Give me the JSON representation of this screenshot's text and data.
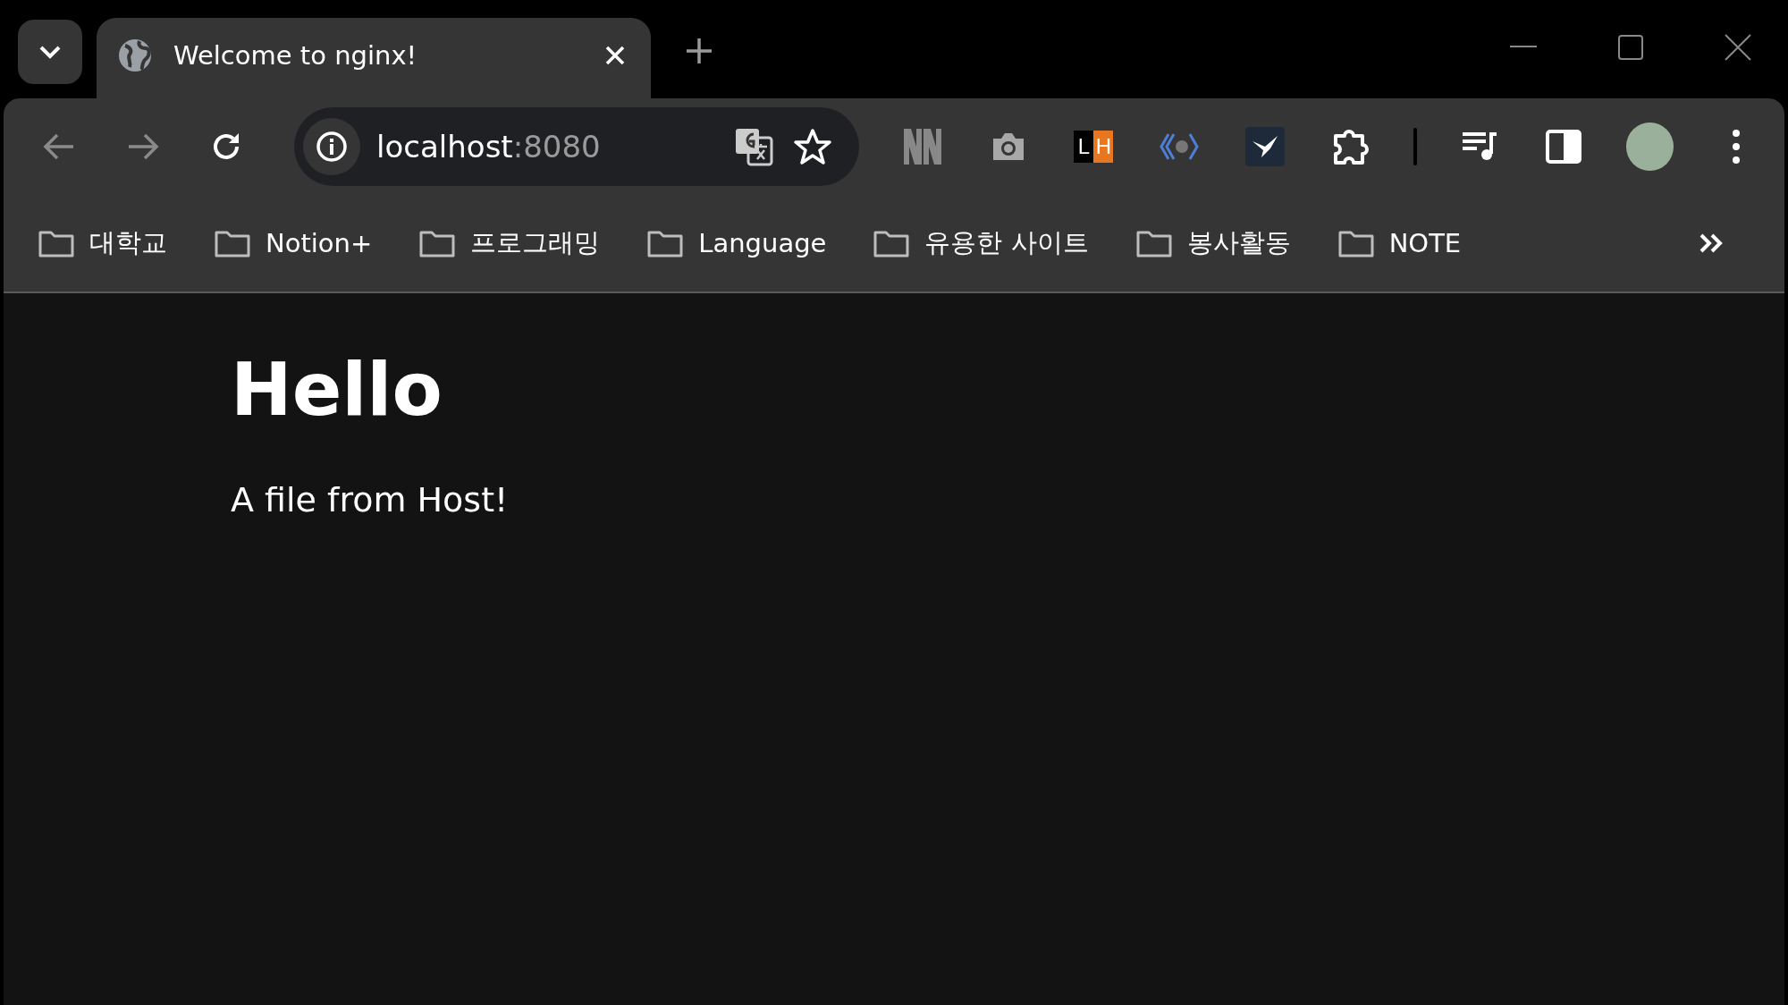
{
  "tab_strip": {
    "tabs": [
      {
        "title": "Welcome to nginx!",
        "selected": true
      }
    ]
  },
  "toolbar": {
    "address": {
      "host": "localhost",
      "port": ":8080"
    },
    "extensions": [
      {
        "kind": "stripes"
      },
      {
        "kind": "camera"
      },
      {
        "kind": "letters",
        "letters": [
          "L",
          "H"
        ]
      },
      {
        "kind": "code"
      },
      {
        "kind": "bird"
      },
      {
        "kind": "puzzle"
      }
    ]
  },
  "bookmarks": [
    {
      "label": "대학교"
    },
    {
      "label": "Notion+"
    },
    {
      "label": "프로그래밍"
    },
    {
      "label": "Language"
    },
    {
      "label": "유용한 사이트"
    },
    {
      "label": "봉사활동"
    },
    {
      "label": "NOTE"
    }
  ],
  "page": {
    "heading": "Hello",
    "paragraph": "A file from Host!"
  }
}
